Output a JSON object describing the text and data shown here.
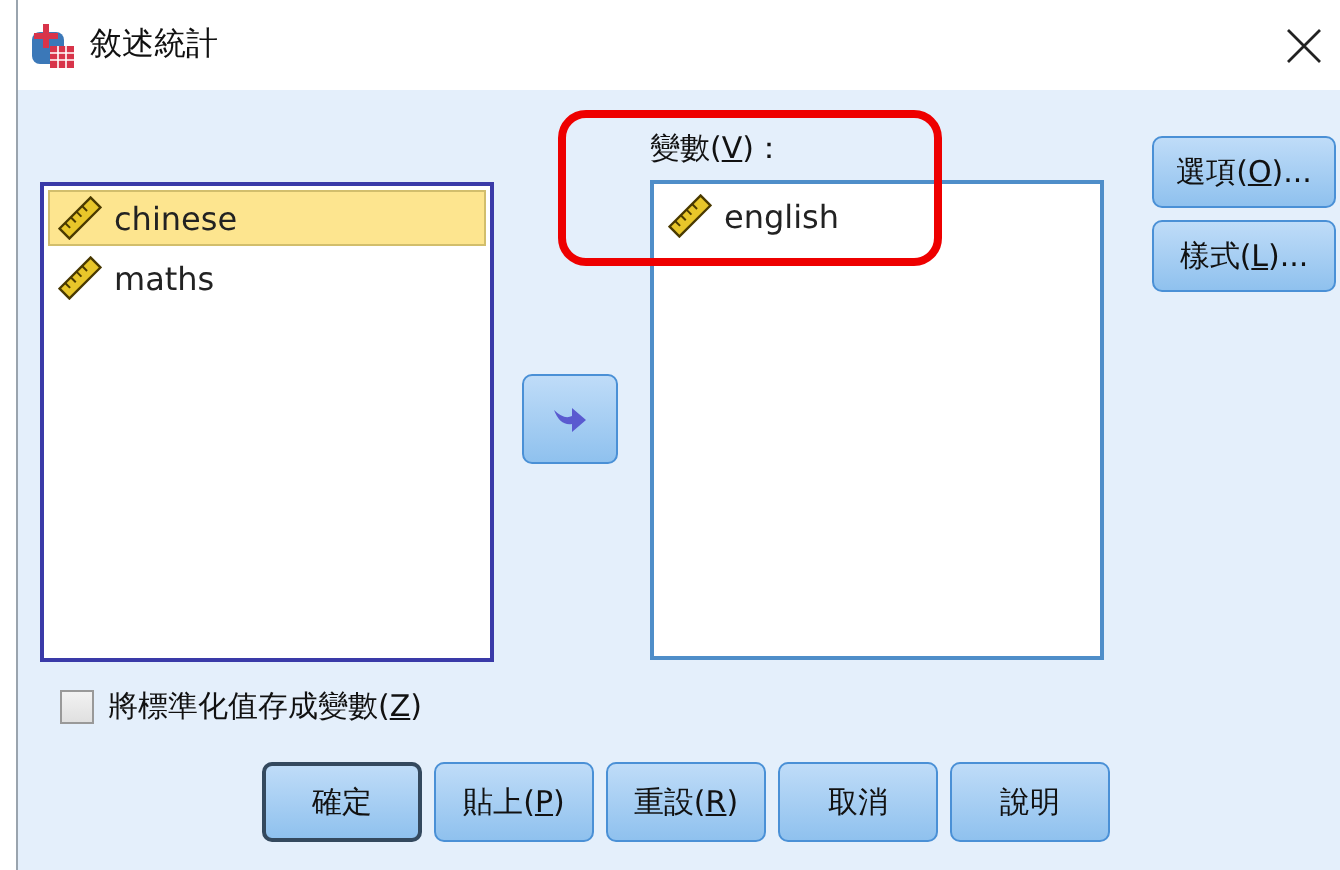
{
  "window": {
    "title": "敘述統計"
  },
  "source_list": {
    "items": [
      {
        "name": "chinese",
        "selected": true
      },
      {
        "name": "maths",
        "selected": false
      }
    ]
  },
  "variables": {
    "label": {
      "before": "變數(",
      "key": "V",
      "after": ")："
    },
    "items": [
      {
        "name": "english",
        "selected": false
      }
    ]
  },
  "side_buttons": [
    {
      "before": "選項(",
      "key": "O",
      "after": ")..."
    },
    {
      "before": "樣式(",
      "key": "L",
      "after": ")..."
    }
  ],
  "save_standardized": {
    "label": {
      "before": "將標準化值存成變數(",
      "key": "Z",
      "after": ")"
    },
    "checked": false
  },
  "buttons": [
    {
      "before": "確定",
      "default": true
    },
    {
      "before": "貼上(",
      "key": "P",
      "after": ")",
      "default": false
    },
    {
      "before": "重設(",
      "key": "R",
      "after": ")",
      "default": false
    },
    {
      "before": "取消",
      "default": false
    },
    {
      "before": "說明",
      "default": false
    }
  ]
}
